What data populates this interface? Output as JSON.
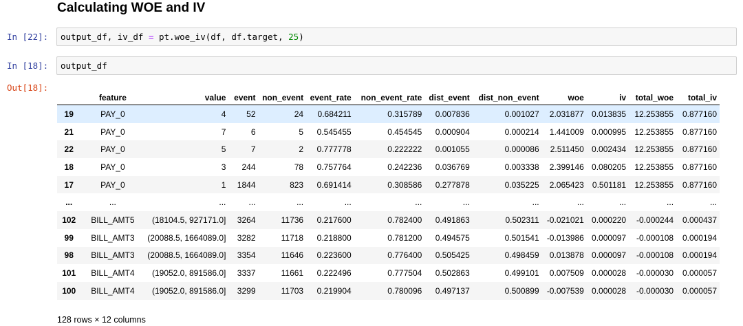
{
  "heading": "Calculating WOE and IV",
  "cells": [
    {
      "prompt": "In [22]:",
      "code_lhs": "output_df, iv_df ",
      "code_op": "=",
      "code_mid": " pt.woe_iv(df, df.target, ",
      "code_num": "25",
      "code_end": ")"
    },
    {
      "prompt": "In [18]:",
      "code": "output_df"
    }
  ],
  "out_prompt": "Out[18]:",
  "table": {
    "columns": [
      "",
      "feature",
      "value",
      "event",
      "non_event",
      "event_rate",
      "non_event_rate",
      "dist_event",
      "dist_non_event",
      "woe",
      "iv",
      "total_woe",
      "total_iv"
    ],
    "rows": [
      [
        "19",
        "PAY_0",
        "4",
        "52",
        "24",
        "0.684211",
        "0.315789",
        "0.007836",
        "0.001027",
        "2.031877",
        "0.013835",
        "12.253855",
        "0.877160"
      ],
      [
        "21",
        "PAY_0",
        "7",
        "6",
        "5",
        "0.545455",
        "0.454545",
        "0.000904",
        "0.000214",
        "1.441009",
        "0.000995",
        "12.253855",
        "0.877160"
      ],
      [
        "22",
        "PAY_0",
        "5",
        "7",
        "2",
        "0.777778",
        "0.222222",
        "0.001055",
        "0.000086",
        "2.511450",
        "0.002434",
        "12.253855",
        "0.877160"
      ],
      [
        "18",
        "PAY_0",
        "3",
        "244",
        "78",
        "0.757764",
        "0.242236",
        "0.036769",
        "0.003338",
        "2.399146",
        "0.080205",
        "12.253855",
        "0.877160"
      ],
      [
        "17",
        "PAY_0",
        "1",
        "1844",
        "823",
        "0.691414",
        "0.308586",
        "0.277878",
        "0.035225",
        "2.065423",
        "0.501181",
        "12.253855",
        "0.877160"
      ],
      [
        "...",
        "...",
        "...",
        "...",
        "...",
        "...",
        "...",
        "...",
        "...",
        "...",
        "...",
        "...",
        "..."
      ],
      [
        "102",
        "BILL_AMT5",
        "(18104.5, 927171.0]",
        "3264",
        "11736",
        "0.217600",
        "0.782400",
        "0.491863",
        "0.502311",
        "-0.021021",
        "0.000220",
        "-0.000244",
        "0.000437"
      ],
      [
        "99",
        "BILL_AMT3",
        "(20088.5, 1664089.0]",
        "3282",
        "11718",
        "0.218800",
        "0.781200",
        "0.494575",
        "0.501541",
        "-0.013986",
        "0.000097",
        "-0.000108",
        "0.000194"
      ],
      [
        "98",
        "BILL_AMT3",
        "(20088.5, 1664089.0]",
        "3354",
        "11646",
        "0.223600",
        "0.776400",
        "0.505425",
        "0.498459",
        "0.013878",
        "0.000097",
        "-0.000108",
        "0.000194"
      ],
      [
        "101",
        "BILL_AMT4",
        "(19052.0, 891586.0]",
        "3337",
        "11661",
        "0.222496",
        "0.777504",
        "0.502863",
        "0.499101",
        "0.007509",
        "0.000028",
        "-0.000030",
        "0.000057"
      ],
      [
        "100",
        "BILL_AMT4",
        "(19052.0, 891586.0]",
        "3299",
        "11703",
        "0.219904",
        "0.780096",
        "0.497137",
        "0.500899",
        "-0.007539",
        "0.000028",
        "-0.000030",
        "0.000057"
      ]
    ],
    "highlighted_row": 0
  },
  "footer": "128 rows × 12 columns"
}
